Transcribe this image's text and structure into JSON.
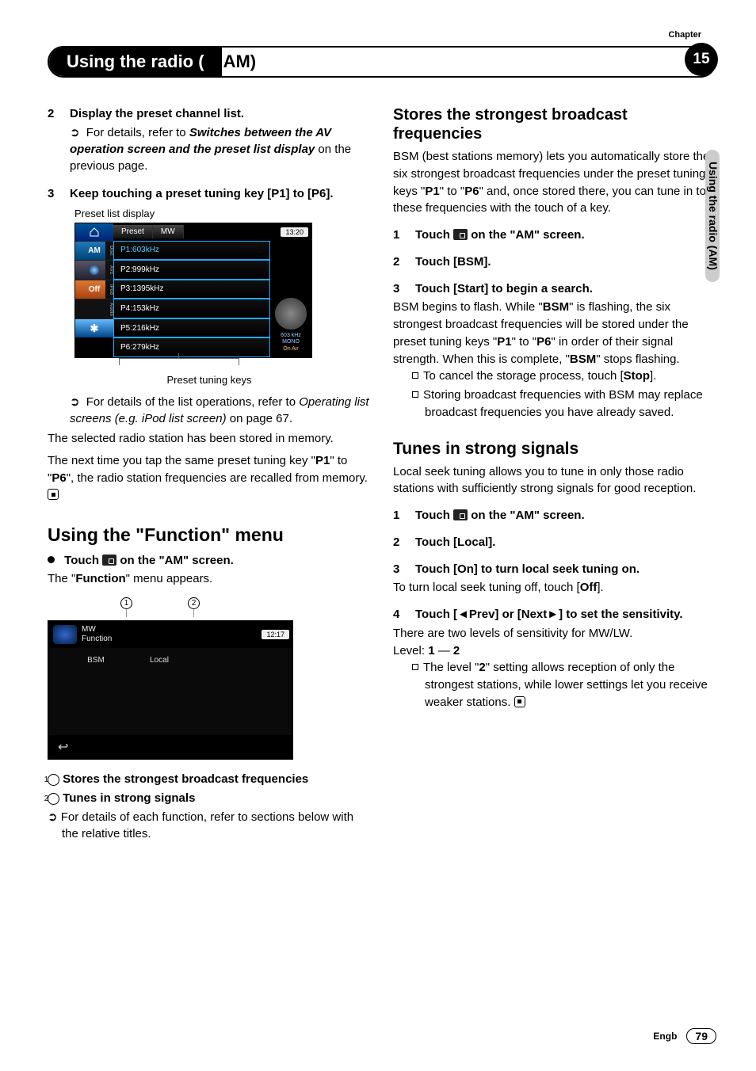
{
  "chapter": {
    "label": "Chapter",
    "number": "15"
  },
  "title_bar": {
    "left": "Using the radio (",
    "right": "AM)"
  },
  "side_tab": "Using the radio (AM)",
  "left": {
    "step2": {
      "num": "2",
      "title": "Display the preset channel list.",
      "note_prefix": "For details, refer to ",
      "note_ital": "Switches between the AV operation screen and the preset list display",
      "note_suffix": " on the previous page."
    },
    "step3": {
      "num": "3",
      "title": "Keep touching a preset tuning key [P1] to [P6]."
    },
    "caption_top": "Preset list display",
    "screenshot1": {
      "tab_preset": "Preset",
      "tab_mw": "MW",
      "time": "13:20",
      "rows": [
        "P1:603kHz",
        "P2:999kHz",
        "P3:1395kHz",
        "P4:153kHz",
        "P5:216kHz",
        "P6:279kHz"
      ],
      "side": {
        "am": "AM",
        "off": "Off",
        "disc": "Disc",
        "av1": "AV1",
        "ipod": "iPod",
        "audio": "Audio"
      },
      "info1": "603 kHz",
      "info2": "MONO",
      "info3": "On Air"
    },
    "caption_bottom": "Preset tuning keys",
    "note2_prefix": "For details of the list operations, refer to ",
    "note2_ital": "Operating list screens (e.g. iPod list screen)",
    "note2_suffix": " on page 67.",
    "para1": "The selected radio station has been stored in memory.",
    "para2a": "The next time you tap the same preset tuning key \"",
    "para2b": "P1",
    "para2c": "\" to \"",
    "para2d": "P6",
    "para2e": "\", the radio station frequencies are recalled from memory.",
    "h2": "Using the \"Function\" menu",
    "touch_line_prefix": "Touch ",
    "touch_line_suffix": " on the \"AM\" screen.",
    "after_touch": "The \"",
    "after_touch_b": "Function",
    "after_touch2": "\" menu appears.",
    "callout1": "1",
    "callout2": "2",
    "screenshot2": {
      "title1": "MW",
      "title2": "Function",
      "time": "12:17",
      "btn1": "BSM",
      "btn2": "Local",
      "back": "↩"
    },
    "legend1_num": "1",
    "legend1": "Stores the strongest broadcast frequencies",
    "legend2_num": "2",
    "legend2": "Tunes in strong signals",
    "legend_note": "For details of each function, refer to sections below with the relative titles."
  },
  "right": {
    "h3a": "Stores the strongest broadcast frequencies",
    "intro_a": "BSM (best stations memory) lets you automatically store the six strongest broadcast frequencies under the preset tuning keys \"",
    "intro_b": "P1",
    "intro_c": "\" to \"",
    "intro_d": "P6",
    "intro_e": "\" and, once stored there, you can tune in to these frequencies with the touch of a key.",
    "s1_num": "1",
    "s1_prefix": "Touch ",
    "s1_suffix": " on the \"AM\" screen.",
    "s2_num": "2",
    "s2": "Touch [BSM].",
    "s3_num": "3",
    "s3": "Touch [Start] to begin a search.",
    "s3_body_a": "BSM begins to flash. While \"",
    "s3_body_b": "BSM",
    "s3_body_c": "\" is flashing, the six strongest broadcast frequencies will be stored under the preset tuning keys \"",
    "s3_body_d": "P1",
    "s3_body_e": "\" to \"",
    "s3_body_f": "P6",
    "s3_body_g": "\" in order of their signal strength. When this is complete, \"",
    "s3_body_h": "BSM",
    "s3_body_i": "\" stops flashing.",
    "sb1_a": "To cancel the storage process, touch [",
    "sb1_b": "Stop",
    "sb1_c": "].",
    "sb2": "Storing broadcast frequencies with BSM may replace broadcast frequencies you have already saved.",
    "h3b": "Tunes in strong signals",
    "intro2": "Local seek tuning allows you to tune in only those radio stations with sufficiently strong signals for good reception.",
    "t1_num": "1",
    "t1_prefix": "Touch ",
    "t1_suffix": " on the \"AM\" screen.",
    "t2_num": "2",
    "t2": "Touch [Local].",
    "t3_num": "3",
    "t3": "Touch [On] to turn local seek tuning on.",
    "t3_body_a": "To turn local seek tuning off, touch [",
    "t3_body_b": "Off",
    "t3_body_c": "].",
    "t4_num": "4",
    "t4": "Touch [◄Prev] or [Next►] to set the sensitivity.",
    "t4_body": "There are two levels of sensitivity for MW/LW.",
    "level_a": "Level: ",
    "level_b": "1",
    "level_c": " — ",
    "level_d": "2",
    "sb3_a": "The level \"",
    "sb3_b": "2",
    "sb3_c": "\" setting allows reception of only the strongest stations, while lower settings let you receive weaker stations."
  },
  "footer": {
    "lang": "Engb",
    "page": "79"
  }
}
